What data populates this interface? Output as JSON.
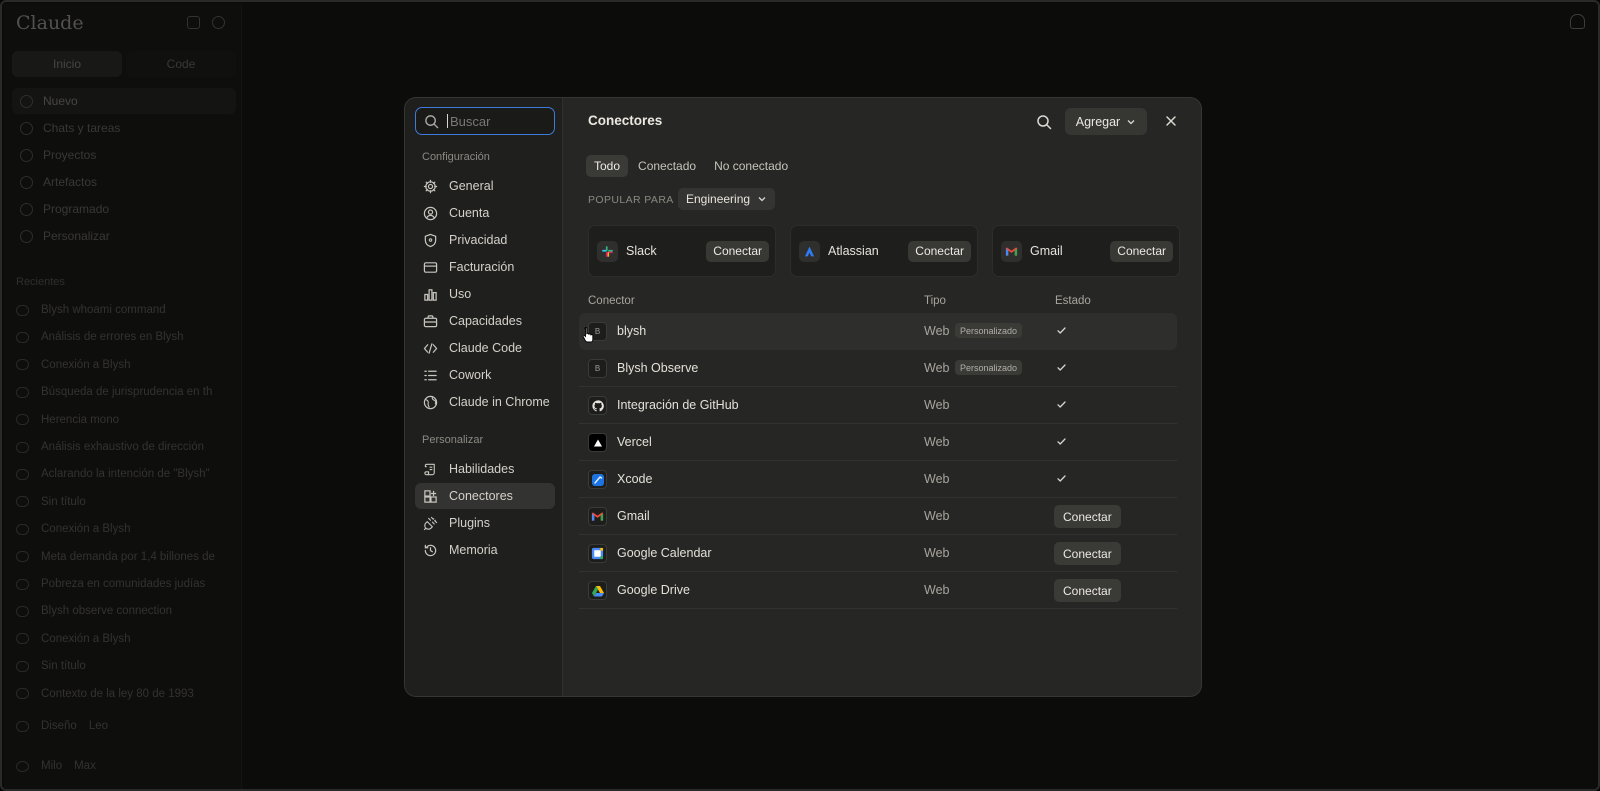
{
  "background_app": {
    "brand": "Claude",
    "modes": [
      "Inicio",
      "Code"
    ],
    "nav": [
      "Nuevo",
      "Chats y tareas",
      "Proyectos",
      "Artefactos",
      "Programado",
      "Personalizar"
    ],
    "recents_label": "Recientes",
    "recents": [
      "Blysh whoami command",
      "Análisis de errores en Blysh",
      "Conexión a Blysh",
      "Búsqueda de jurisprudencia en th",
      "Herencia mono",
      "Análisis exhaustivo de dirección",
      "Aclarando la intención de \"Blysh\"",
      "Sin título",
      "Conexión a Blysh",
      "Meta demanda por 1,4 billones de",
      "Pobreza en comunidades judías",
      "Blysh observe connection",
      "Conexión a Blysh",
      "Sin título",
      "Contexto de la ley 80 de 1993"
    ],
    "footer_item": "Diseño",
    "footer_badge": "Leo",
    "user_name": "Milo",
    "user_plan": "Max"
  },
  "settings": {
    "search": {
      "placeholder": "Buscar",
      "value": ""
    },
    "group_config": "Configuración",
    "config_items": [
      {
        "label": "General",
        "icon": "gear-icon"
      },
      {
        "label": "Cuenta",
        "icon": "user-circle-icon"
      },
      {
        "label": "Privacidad",
        "icon": "shield-icon"
      },
      {
        "label": "Facturación",
        "icon": "credit-card-icon"
      },
      {
        "label": "Uso",
        "icon": "bar-chart-icon"
      },
      {
        "label": "Capacidades",
        "icon": "briefcase-icon"
      },
      {
        "label": "Claude Code",
        "icon": "code-icon"
      },
      {
        "label": "Cowork",
        "icon": "checklist-icon"
      },
      {
        "label": "Claude in Chrome",
        "icon": "globe-icon"
      }
    ],
    "group_personalize": "Personalizar",
    "personalize_items": [
      {
        "label": "Habilidades",
        "icon": "scroll-icon"
      },
      {
        "label": "Conectores",
        "icon": "grid-plus-icon",
        "active": true
      },
      {
        "label": "Plugins",
        "icon": "plug-icon"
      },
      {
        "label": "Memoria",
        "icon": "history-icon"
      }
    ]
  },
  "connectors": {
    "title": "Conectores",
    "add_label": "Agregar",
    "tabs": [
      "Todo",
      "Conectado",
      "No conectado"
    ],
    "active_tab": "Todo",
    "popular_label": "POPULAR PARA",
    "popular_selected": "Engineering",
    "popular": [
      {
        "name": "Slack",
        "action": "Conectar",
        "icon": "slack-icon"
      },
      {
        "name": "Atlassian",
        "action": "Conectar",
        "icon": "atlassian-icon"
      },
      {
        "name": "Gmail",
        "action": "Conectar",
        "icon": "gmail-icon"
      }
    ],
    "columns": [
      "Conector",
      "Tipo",
      "Estado"
    ],
    "rows": [
      {
        "name": "blysh",
        "type": "Web",
        "badge": "Personalizado",
        "status": "connected",
        "logo": "B"
      },
      {
        "name": "Blysh Observe",
        "type": "Web",
        "badge": "Personalizado",
        "status": "connected",
        "logo": "B"
      },
      {
        "name": "Integración de GitHub",
        "type": "Web",
        "status": "connected",
        "icon": "github-icon"
      },
      {
        "name": "Vercel",
        "type": "Web",
        "status": "connected",
        "icon": "vercel-icon"
      },
      {
        "name": "Xcode",
        "type": "Web",
        "status": "connected",
        "icon": "xcode-icon"
      },
      {
        "name": "Gmail",
        "type": "Web",
        "status": "Conectar",
        "icon": "gmail-icon"
      },
      {
        "name": "Google Calendar",
        "type": "Web",
        "status": "Conectar",
        "icon": "google-calendar-icon"
      },
      {
        "name": "Google Drive",
        "type": "Web",
        "status": "Conectar",
        "icon": "google-drive-icon"
      }
    ]
  },
  "colors": {
    "accent_focus": "#3e7bd8",
    "modal_bg": "#262624",
    "modal_sidebar_bg": "#1f1f1e",
    "page_bg": "#0c0c0b"
  }
}
